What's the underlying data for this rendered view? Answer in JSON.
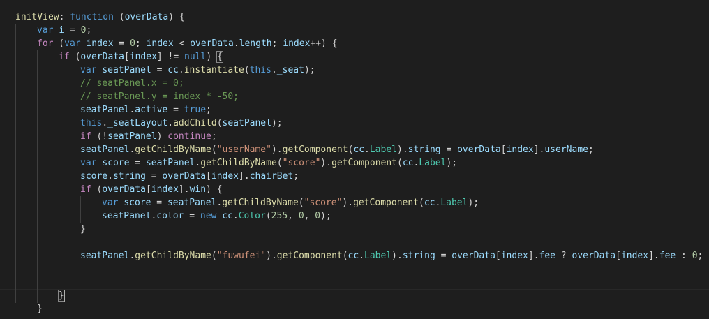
{
  "editor": {
    "theme": {
      "background": "#1e1e1e",
      "default": "#d4d4d4",
      "keyword": "#569cd6",
      "control": "#c586c0",
      "function": "#dcdcaa",
      "variable": "#9cdcfe",
      "number": "#b5cea8",
      "string": "#ce9178",
      "comment": "#6a9955",
      "type": "#4ec9b0"
    },
    "lines": [
      {
        "indent": 0,
        "tokens": [
          [
            "f",
            "initView"
          ],
          [
            "o",
            ": "
          ],
          [
            "k",
            "function"
          ],
          [
            "o",
            " ("
          ],
          [
            "v",
            "overData"
          ],
          [
            "o",
            ") {"
          ]
        ]
      },
      {
        "indent": 1,
        "tokens": [
          [
            "k",
            "var"
          ],
          [
            "o",
            " "
          ],
          [
            "v",
            "i"
          ],
          [
            "o",
            " = "
          ],
          [
            "n",
            "0"
          ],
          [
            "o",
            ";"
          ]
        ]
      },
      {
        "indent": 1,
        "tokens": [
          [
            "c",
            "for"
          ],
          [
            "o",
            " ("
          ],
          [
            "k",
            "var"
          ],
          [
            "o",
            " "
          ],
          [
            "v",
            "index"
          ],
          [
            "o",
            " = "
          ],
          [
            "n",
            "0"
          ],
          [
            "o",
            "; "
          ],
          [
            "v",
            "index"
          ],
          [
            "o",
            " < "
          ],
          [
            "v",
            "overData"
          ],
          [
            "o",
            "."
          ],
          [
            "v",
            "length"
          ],
          [
            "o",
            "; "
          ],
          [
            "v",
            "index"
          ],
          [
            "o",
            "++) {"
          ]
        ]
      },
      {
        "indent": 2,
        "tokens": [
          [
            "c",
            "if"
          ],
          [
            "o",
            " ("
          ],
          [
            "v",
            "overData"
          ],
          [
            "o",
            "["
          ],
          [
            "v",
            "index"
          ],
          [
            "o",
            "] != "
          ],
          [
            "k",
            "null"
          ],
          [
            "o",
            ") "
          ],
          [
            "b",
            "{"
          ]
        ]
      },
      {
        "indent": 3,
        "tokens": [
          [
            "k",
            "var"
          ],
          [
            "o",
            " "
          ],
          [
            "v",
            "seatPanel"
          ],
          [
            "o",
            " = "
          ],
          [
            "v",
            "cc"
          ],
          [
            "o",
            "."
          ],
          [
            "f",
            "instantiate"
          ],
          [
            "o",
            "("
          ],
          [
            "k",
            "this"
          ],
          [
            "o",
            "."
          ],
          [
            "v",
            "_seat"
          ],
          [
            "o",
            ");"
          ]
        ]
      },
      {
        "indent": 3,
        "tokens": [
          [
            "m",
            "// seatPanel.x = 0;"
          ]
        ]
      },
      {
        "indent": 3,
        "tokens": [
          [
            "m",
            "// seatPanel.y = index * -50;"
          ]
        ]
      },
      {
        "indent": 3,
        "tokens": [
          [
            "v",
            "seatPanel"
          ],
          [
            "o",
            "."
          ],
          [
            "v",
            "active"
          ],
          [
            "o",
            " = "
          ],
          [
            "k",
            "true"
          ],
          [
            "o",
            ";"
          ]
        ]
      },
      {
        "indent": 3,
        "tokens": [
          [
            "k",
            "this"
          ],
          [
            "o",
            "."
          ],
          [
            "v",
            "_seatLayout"
          ],
          [
            "o",
            "."
          ],
          [
            "f",
            "addChild"
          ],
          [
            "o",
            "("
          ],
          [
            "v",
            "seatPanel"
          ],
          [
            "o",
            ");"
          ]
        ]
      },
      {
        "indent": 3,
        "tokens": [
          [
            "c",
            "if"
          ],
          [
            "o",
            " (!"
          ],
          [
            "v",
            "seatPanel"
          ],
          [
            "o",
            ") "
          ],
          [
            "c",
            "continue"
          ],
          [
            "o",
            ";"
          ]
        ]
      },
      {
        "indent": 3,
        "tokens": [
          [
            "v",
            "seatPanel"
          ],
          [
            "o",
            "."
          ],
          [
            "f",
            "getChildByName"
          ],
          [
            "o",
            "("
          ],
          [
            "s",
            "\"userName\""
          ],
          [
            "o",
            ")."
          ],
          [
            "f",
            "getComponent"
          ],
          [
            "o",
            "("
          ],
          [
            "v",
            "cc"
          ],
          [
            "o",
            "."
          ],
          [
            "t",
            "Label"
          ],
          [
            "o",
            ")."
          ],
          [
            "v",
            "string"
          ],
          [
            "o",
            " = "
          ],
          [
            "v",
            "overData"
          ],
          [
            "o",
            "["
          ],
          [
            "v",
            "index"
          ],
          [
            "o",
            "]."
          ],
          [
            "v",
            "userName"
          ],
          [
            "o",
            ";"
          ]
        ]
      },
      {
        "indent": 3,
        "tokens": [
          [
            "k",
            "var"
          ],
          [
            "o",
            " "
          ],
          [
            "v",
            "score"
          ],
          [
            "o",
            " = "
          ],
          [
            "v",
            "seatPanel"
          ],
          [
            "o",
            "."
          ],
          [
            "f",
            "getChildByName"
          ],
          [
            "o",
            "("
          ],
          [
            "s",
            "\"score\""
          ],
          [
            "o",
            ")."
          ],
          [
            "f",
            "getComponent"
          ],
          [
            "o",
            "("
          ],
          [
            "v",
            "cc"
          ],
          [
            "o",
            "."
          ],
          [
            "t",
            "Label"
          ],
          [
            "o",
            ");"
          ]
        ]
      },
      {
        "indent": 3,
        "tokens": [
          [
            "v",
            "score"
          ],
          [
            "o",
            "."
          ],
          [
            "v",
            "string"
          ],
          [
            "o",
            " = "
          ],
          [
            "v",
            "overData"
          ],
          [
            "o",
            "["
          ],
          [
            "v",
            "index"
          ],
          [
            "o",
            "]."
          ],
          [
            "v",
            "chairBet"
          ],
          [
            "o",
            ";"
          ]
        ]
      },
      {
        "indent": 3,
        "tokens": [
          [
            "c",
            "if"
          ],
          [
            "o",
            " ("
          ],
          [
            "v",
            "overData"
          ],
          [
            "o",
            "["
          ],
          [
            "v",
            "index"
          ],
          [
            "o",
            "]."
          ],
          [
            "v",
            "win"
          ],
          [
            "o",
            ") {"
          ]
        ]
      },
      {
        "indent": 4,
        "tokens": [
          [
            "k",
            "var"
          ],
          [
            "o",
            " "
          ],
          [
            "v",
            "score"
          ],
          [
            "o",
            " = "
          ],
          [
            "v",
            "seatPanel"
          ],
          [
            "o",
            "."
          ],
          [
            "f",
            "getChildByName"
          ],
          [
            "o",
            "("
          ],
          [
            "s",
            "\"score\""
          ],
          [
            "o",
            ")."
          ],
          [
            "f",
            "getComponent"
          ],
          [
            "o",
            "("
          ],
          [
            "v",
            "cc"
          ],
          [
            "o",
            "."
          ],
          [
            "t",
            "Label"
          ],
          [
            "o",
            ");"
          ]
        ]
      },
      {
        "indent": 4,
        "tokens": [
          [
            "v",
            "seatPanel"
          ],
          [
            "o",
            "."
          ],
          [
            "v",
            "color"
          ],
          [
            "o",
            " = "
          ],
          [
            "k",
            "new"
          ],
          [
            "o",
            " "
          ],
          [
            "v",
            "cc"
          ],
          [
            "o",
            "."
          ],
          [
            "t",
            "Color"
          ],
          [
            "o",
            "("
          ],
          [
            "n",
            "255"
          ],
          [
            "o",
            ", "
          ],
          [
            "n",
            "0"
          ],
          [
            "o",
            ", "
          ],
          [
            "n",
            "0"
          ],
          [
            "o",
            ");"
          ]
        ]
      },
      {
        "indent": 3,
        "tokens": [
          [
            "o",
            "}"
          ]
        ]
      },
      {
        "indent": 0,
        "tokens": []
      },
      {
        "indent": 3,
        "tokens": [
          [
            "v",
            "seatPanel"
          ],
          [
            "o",
            "."
          ],
          [
            "f",
            "getChildByName"
          ],
          [
            "o",
            "("
          ],
          [
            "s",
            "\"fuwufei\""
          ],
          [
            "o",
            ")."
          ],
          [
            "f",
            "getComponent"
          ],
          [
            "o",
            "("
          ],
          [
            "v",
            "cc"
          ],
          [
            "o",
            "."
          ],
          [
            "t",
            "Label"
          ],
          [
            "o",
            ")."
          ],
          [
            "v",
            "string"
          ],
          [
            "o",
            " = "
          ],
          [
            "v",
            "overData"
          ],
          [
            "o",
            "["
          ],
          [
            "v",
            "index"
          ],
          [
            "o",
            "]."
          ],
          [
            "v",
            "fee"
          ],
          [
            "o",
            " ? "
          ],
          [
            "v",
            "overData"
          ],
          [
            "o",
            "["
          ],
          [
            "v",
            "index"
          ],
          [
            "o",
            "]."
          ],
          [
            "v",
            "fee"
          ],
          [
            "o",
            " : "
          ],
          [
            "n",
            "0"
          ],
          [
            "o",
            ";"
          ]
        ]
      },
      {
        "indent": 0,
        "tokens": []
      },
      {
        "indent": 0,
        "tokens": []
      },
      {
        "indent": 2,
        "tokens": [
          [
            "b",
            "}"
          ]
        ]
      },
      {
        "indent": 1,
        "tokens": [
          [
            "o",
            "}"
          ]
        ]
      }
    ]
  }
}
